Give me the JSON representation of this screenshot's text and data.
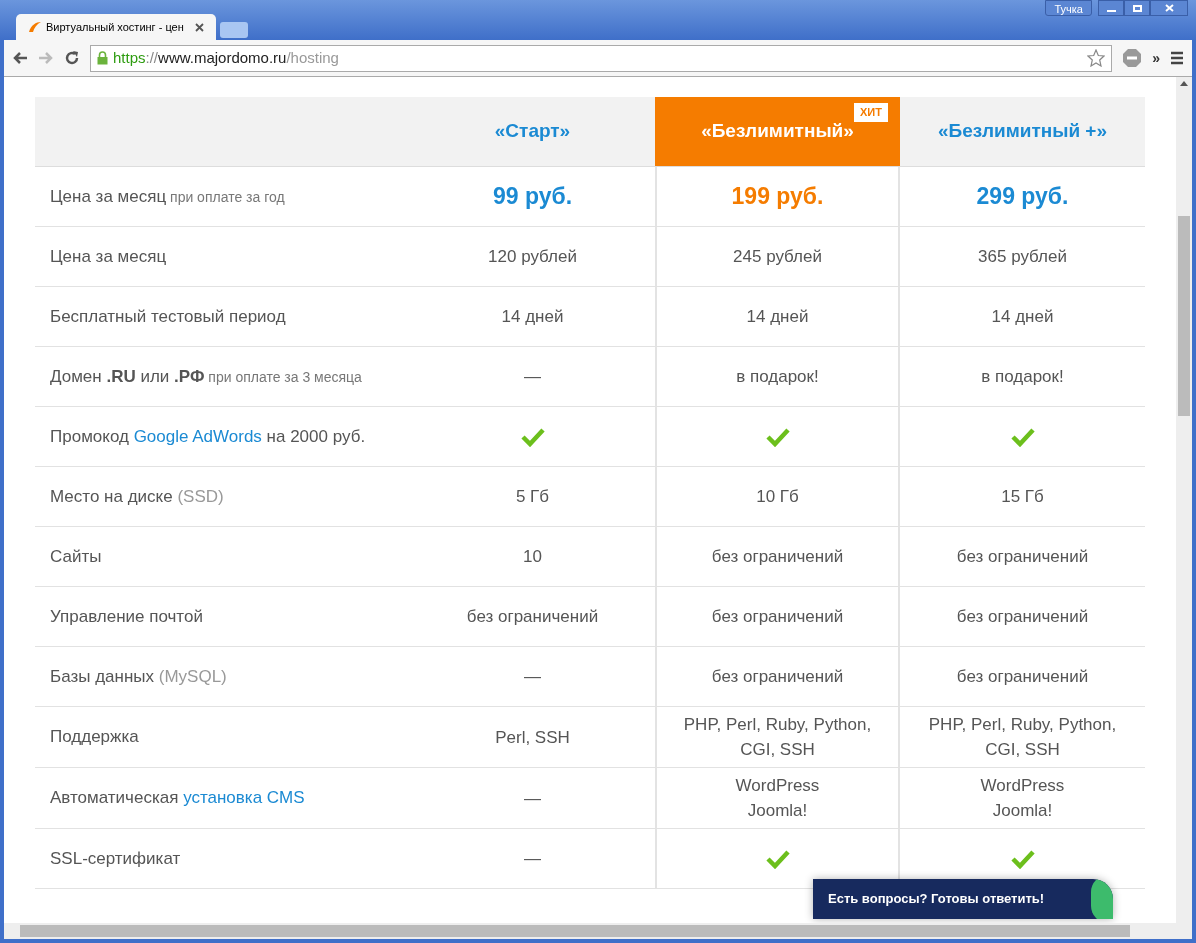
{
  "browser": {
    "tab_title": "Виртуальный хостинг - цен",
    "user": "Тучка",
    "url_scheme": "https",
    "url_sep": "://",
    "url_host": "www.majordomo.ru",
    "url_path": "/hosting",
    "toolbar_more": "»"
  },
  "table": {
    "plans": [
      {
        "name": "«Старт»",
        "highlighted": false
      },
      {
        "name": "«Безлимитный»",
        "highlighted": true,
        "badge": "ХИТ"
      },
      {
        "name": "«Безлимитный +»",
        "highlighted": false
      }
    ],
    "rows": [
      {
        "label": [
          {
            "kind": "plain",
            "text": "Цена за месяц"
          },
          {
            "kind": "note",
            "text": "при оплате за год"
          }
        ],
        "cells": [
          {
            "kind": "price",
            "text": "99 руб."
          },
          {
            "kind": "price",
            "text": "199 руб."
          },
          {
            "kind": "price",
            "text": "299 руб."
          }
        ]
      },
      {
        "label": [
          {
            "kind": "plain",
            "text": "Цена за месяц"
          }
        ],
        "cells": [
          {
            "kind": "text",
            "text": "120 рублей"
          },
          {
            "kind": "text",
            "text": "245 рублей"
          },
          {
            "kind": "text",
            "text": "365 рублей"
          }
        ]
      },
      {
        "label": [
          {
            "kind": "plain",
            "text": "Бесплатный тестовый период"
          }
        ],
        "cells": [
          {
            "kind": "text",
            "text": "14 дней"
          },
          {
            "kind": "text",
            "text": "14 дней"
          },
          {
            "kind": "text",
            "text": "14 дней"
          }
        ]
      },
      {
        "label": [
          {
            "kind": "plain",
            "text": "Домен **.RU** или **.РФ**"
          },
          {
            "kind": "note",
            "text": "при оплате за 3 месяца"
          }
        ],
        "cells": [
          {
            "kind": "text",
            "text": "—"
          },
          {
            "kind": "text",
            "text": "в подарок!"
          },
          {
            "kind": "text",
            "text": "в подарок!"
          }
        ]
      },
      {
        "label": [
          {
            "kind": "plain",
            "text": "Промокод"
          },
          {
            "kind": "link",
            "text": "Google AdWords"
          },
          {
            "kind": "plain",
            "text": "на 2000 руб."
          }
        ],
        "cells": [
          {
            "kind": "check"
          },
          {
            "kind": "check"
          },
          {
            "kind": "check"
          }
        ]
      },
      {
        "label": [
          {
            "kind": "plain",
            "text": "Место на диске"
          },
          {
            "kind": "muted",
            "text": "(SSD)"
          }
        ],
        "cells": [
          {
            "kind": "text",
            "text": "5 Гб"
          },
          {
            "kind": "text",
            "text": "10 Гб"
          },
          {
            "kind": "text",
            "text": "15 Гб"
          }
        ]
      },
      {
        "label": [
          {
            "kind": "plain",
            "text": "Сайты"
          }
        ],
        "cells": [
          {
            "kind": "text",
            "text": "10"
          },
          {
            "kind": "text",
            "text": "без ограничений"
          },
          {
            "kind": "text",
            "text": "без ограничений"
          }
        ]
      },
      {
        "label": [
          {
            "kind": "plain",
            "text": "Управление почтой"
          }
        ],
        "cells": [
          {
            "kind": "text",
            "text": "без ограничений"
          },
          {
            "kind": "text",
            "text": "без ограничений"
          },
          {
            "kind": "text",
            "text": "без ограничений"
          }
        ]
      },
      {
        "label": [
          {
            "kind": "plain",
            "text": "Базы данных"
          },
          {
            "kind": "muted",
            "text": "(MySQL)"
          }
        ],
        "cells": [
          {
            "kind": "text",
            "text": "—"
          },
          {
            "kind": "text",
            "text": "без ограничений"
          },
          {
            "kind": "text",
            "text": "без ограничений"
          }
        ]
      },
      {
        "label": [
          {
            "kind": "plain",
            "text": "Поддержка"
          }
        ],
        "cells": [
          {
            "kind": "text",
            "text": "Perl, SSH"
          },
          {
            "kind": "text",
            "text": "PHP, Perl, Ruby, Python, CGI, SSH"
          },
          {
            "kind": "text",
            "text": "PHP, Perl, Ruby, Python, CGI, SSH"
          }
        ]
      },
      {
        "label": [
          {
            "kind": "plain",
            "text": "Автоматическая"
          },
          {
            "kind": "link",
            "text": "установка CMS"
          }
        ],
        "cells": [
          {
            "kind": "text",
            "text": "—"
          },
          {
            "kind": "lines",
            "lines": [
              "WordPress",
              "Joomla!"
            ]
          },
          {
            "kind": "lines",
            "lines": [
              "WordPress",
              "Joomla!"
            ]
          }
        ]
      },
      {
        "label": [
          {
            "kind": "plain",
            "text": "SSL-сертификат"
          }
        ],
        "cells": [
          {
            "kind": "text",
            "text": "—"
          },
          {
            "kind": "check"
          },
          {
            "kind": "check"
          }
        ]
      }
    ]
  },
  "chat_widget": {
    "text": "Есть вопросы? Готовы ответить!"
  }
}
